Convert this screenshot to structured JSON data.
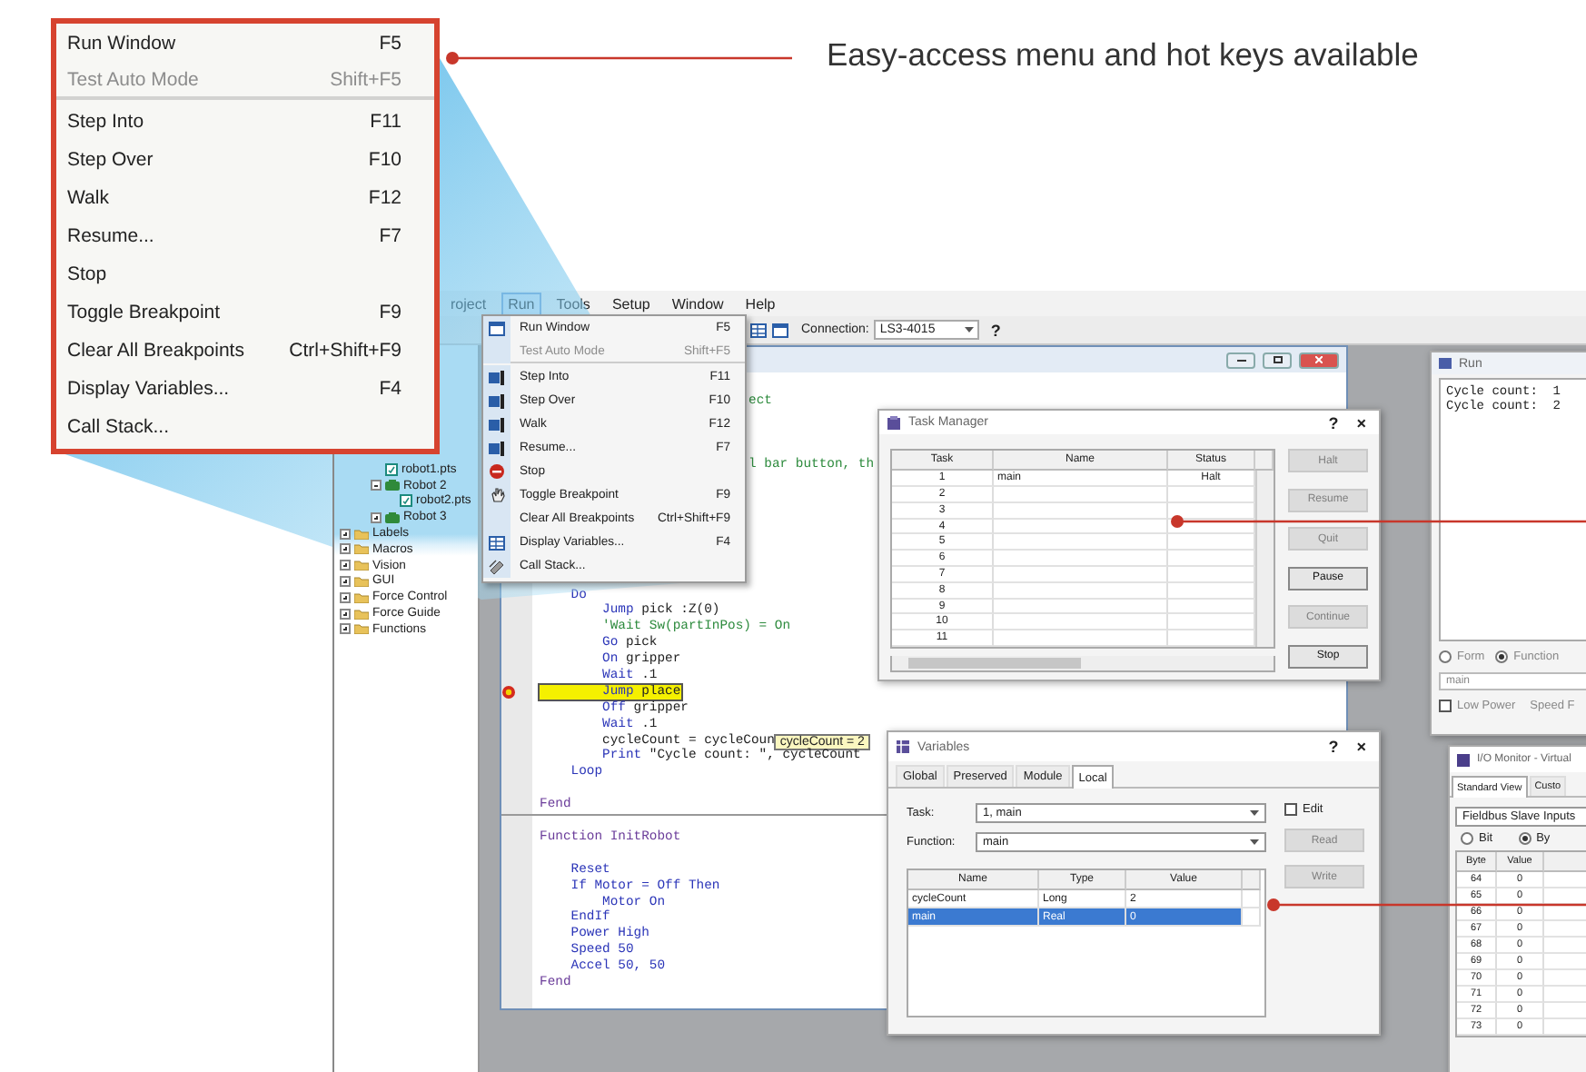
{
  "callout": {
    "caption": "Easy-access menu and hot keys available"
  },
  "zoomed_menu": {
    "items": [
      {
        "label": "Run Window",
        "shortcut": "F5",
        "disabled": false,
        "separator_after": false
      },
      {
        "label": "Test Auto Mode",
        "shortcut": "Shift+F5",
        "disabled": true,
        "separator_after": true
      },
      {
        "label": "Step Into",
        "shortcut": "F11",
        "disabled": false,
        "separator_after": false
      },
      {
        "label": "Step Over",
        "shortcut": "F10",
        "disabled": false,
        "separator_after": false
      },
      {
        "label": "Walk",
        "shortcut": "F12",
        "disabled": false,
        "separator_after": false
      },
      {
        "label": "Resume...",
        "shortcut": "F7",
        "disabled": false,
        "separator_after": false
      },
      {
        "label": "Stop",
        "disabled": false,
        "separator_after": false
      },
      {
        "label": "Toggle Breakpoint",
        "shortcut": "F9",
        "disabled": false,
        "separator_after": false
      },
      {
        "label": "Clear All Breakpoints",
        "shortcut": "Ctrl+Shift+F9",
        "disabled": false,
        "separator_after": false
      },
      {
        "label": "Display Variables...",
        "shortcut": "F4",
        "disabled": false,
        "separator_after": false
      },
      {
        "label": "Call Stack...",
        "disabled": false,
        "separator_after": false
      }
    ]
  },
  "menu_bar": [
    {
      "label": "roject",
      "selected": false
    },
    {
      "label": "Run",
      "selected": true
    },
    {
      "label": "Tools",
      "selected": false
    },
    {
      "label": "Setup",
      "selected": false
    },
    {
      "label": "Window",
      "selected": false
    },
    {
      "label": "Help",
      "selected": false
    }
  ],
  "toolbar": {
    "connection_label": "Connection:",
    "connection": "LS3-4015",
    "help": "?"
  },
  "tree": {
    "robots": [
      {
        "label": "robot1.pts",
        "kind": "file"
      },
      {
        "label": "Robot 2",
        "kind": "robot",
        "expanded": true,
        "children": [
          {
            "label": "robot2.pts",
            "kind": "file"
          }
        ]
      },
      {
        "label": "Robot 3",
        "kind": "robot",
        "expanded": false
      }
    ],
    "folders": [
      {
        "label": "Labels",
        "expanded": false
      },
      {
        "label": "Macros",
        "expanded": false
      },
      {
        "label": "Vision",
        "expanded": false
      },
      {
        "label": "GUI",
        "expanded": false
      },
      {
        "label": "Force Control",
        "expanded": false
      },
      {
        "label": "Force Guide",
        "expanded": false
      },
      {
        "label": "Functions",
        "expanded": false
      }
    ]
  },
  "run_menu": {
    "items": [
      {
        "label": "Run Window",
        "shortcut": "F5",
        "disabled": false,
        "separator_after": false
      },
      {
        "label": "Test Auto Mode",
        "shortcut": "Shift+F5",
        "disabled": true,
        "separator_after": true
      },
      {
        "label": "Step Into",
        "shortcut": "F11",
        "disabled": false,
        "separator_after": false
      },
      {
        "label": "Step Over",
        "shortcut": "F10",
        "disabled": false,
        "separator_after": false
      },
      {
        "label": "Walk",
        "shortcut": "F12",
        "disabled": false,
        "separator_after": false
      },
      {
        "label": "Resume...",
        "shortcut": "F7",
        "disabled": false,
        "separator_after": false
      },
      {
        "label": "Stop",
        "disabled": false,
        "separator_after": false
      },
      {
        "label": "Toggle Breakpoint",
        "shortcut": "F9",
        "disabled": false,
        "separator_after": false
      },
      {
        "label": "Clear All Breakpoints",
        "shortcut": "Ctrl+Shift+F9",
        "disabled": false,
        "separator_after": false
      },
      {
        "label": "Display Variables...",
        "shortcut": "F4",
        "disabled": false,
        "separator_after": false
      },
      {
        "label": "Call Stack...",
        "disabled": false,
        "separator_after": false
      }
    ]
  },
  "editor": {
    "lines": [
      {
        "kind": "blank"
      },
      {
        "kind": "fragment",
        "text": "ect"
      },
      {
        "kind": "blank"
      },
      {
        "kind": "blank"
      },
      {
        "kind": "blank"
      },
      {
        "kind": "fragment",
        "text": "l bar button, th"
      },
      {
        "kind": "blank"
      },
      {
        "kind": "blank"
      },
      {
        "kind": "blank"
      },
      {
        "kind": "blank"
      },
      {
        "kind": "blank"
      },
      {
        "kind": "blank"
      },
      {
        "kind": "blank"
      },
      {
        "kind": "code",
        "keyword": "    Do"
      },
      {
        "kind": "code",
        "keyword": "        Jump",
        "text": " pick :Z(0)"
      },
      {
        "kind": "comment",
        "text": "        'Wait Sw(partInPos) = On"
      },
      {
        "kind": "code",
        "keyword": "        Go",
        "text": " pick"
      },
      {
        "kind": "code",
        "keyword": "        On",
        "text": " gripper"
      },
      {
        "kind": "code",
        "keyword": "        Wait",
        "text": " .1"
      },
      {
        "kind": "code",
        "keyword": "        Jump",
        "text": " place",
        "current": true,
        "breakpoint": true
      },
      {
        "kind": "code",
        "keyword": "        Off",
        "text": " gripper"
      },
      {
        "kind": "code",
        "keyword": "        Wait",
        "text": " .1"
      },
      {
        "kind": "code",
        "text": "        cycleCount = cycleCoun",
        "tooltip": "cycleCount = 2"
      },
      {
        "kind": "code",
        "keyword": "        Print",
        "text": " \"Cycle count: \", cycleCount"
      },
      {
        "kind": "code",
        "keyword": "    Loop"
      },
      {
        "kind": "blank"
      },
      {
        "kind": "block",
        "text": "Fend"
      },
      {
        "kind": "divider"
      },
      {
        "kind": "block",
        "text": "Function InitRobot"
      },
      {
        "kind": "blank"
      },
      {
        "kind": "code",
        "keyword": "    Reset"
      },
      {
        "kind": "code",
        "keyword": "    If Motor = Off Then"
      },
      {
        "kind": "code",
        "keyword": "        Motor On"
      },
      {
        "kind": "code",
        "keyword": "    EndIf"
      },
      {
        "kind": "code",
        "keyword": "    Power High"
      },
      {
        "kind": "code",
        "keyword": "    Speed 50"
      },
      {
        "kind": "code",
        "keyword": "    Accel 50, 50"
      },
      {
        "kind": "block",
        "text": "Fend"
      }
    ]
  },
  "task_manager": {
    "title": "Task Manager",
    "help": "?",
    "close": "×",
    "columns": [
      "Task",
      "Name",
      "Status"
    ],
    "rows": [
      [
        "1",
        "main",
        "Halt"
      ],
      [
        "2"
      ],
      [
        "3"
      ],
      [
        "4"
      ],
      [
        "5"
      ],
      [
        "6"
      ],
      [
        "7"
      ],
      [
        "8"
      ],
      [
        "9"
      ],
      [
        "10"
      ],
      [
        "11"
      ]
    ],
    "buttons": [
      {
        "label": "Halt",
        "disabled": true
      },
      {
        "label": "Resume",
        "disabled": true
      },
      {
        "label": "Quit",
        "disabled": true
      },
      {
        "label": "Pause",
        "disabled": false
      },
      {
        "label": "Continue",
        "disabled": true
      },
      {
        "label": "Stop",
        "disabled": false
      }
    ]
  },
  "variables": {
    "title": "Variables",
    "help": "?",
    "close": "×",
    "tabs": [
      {
        "label": "Global",
        "selected": false
      },
      {
        "label": "Preserved",
        "selected": false
      },
      {
        "label": "Module",
        "selected": false
      },
      {
        "label": "Local",
        "selected": true
      }
    ],
    "task_label": "Task:",
    "task": "1, main",
    "function_label": "Function:",
    "function": "main",
    "edit": {
      "label": "Edit",
      "checked": false
    },
    "buttons": [
      {
        "label": "Read",
        "disabled": true
      },
      {
        "label": "Write",
        "disabled": true
      }
    ],
    "columns": [
      "Name",
      "Type",
      "Value"
    ],
    "rows": [
      {
        "cells": [
          "cycleCount",
          "Long",
          "2"
        ],
        "selected": false
      },
      {
        "cells": [
          "main",
          "Real",
          "0"
        ],
        "selected": true
      }
    ]
  },
  "run_window": {
    "title": "Run",
    "output": [
      "Cycle count:  1",
      "Cycle count:  2"
    ],
    "radios": [
      {
        "label": "Form",
        "selected": false
      },
      {
        "label": "Function",
        "selected": true
      }
    ],
    "function": "main",
    "low_power": {
      "label": "Low Power",
      "checked": false
    },
    "speed_label": "Speed F"
  },
  "io_monitor": {
    "title": "I/O Monitor - Virtual",
    "tabs": [
      {
        "label": "Standard View",
        "selected": true
      },
      {
        "label": "Custo",
        "selected": false
      }
    ],
    "source": "Fieldbus Slave Inputs",
    "radios": [
      {
        "label": "Bit",
        "selected": false
      },
      {
        "label": "By",
        "selected": true
      }
    ],
    "columns": [
      "Byte",
      "Value"
    ],
    "rows": [
      [
        "64",
        "0"
      ],
      [
        "65",
        "0"
      ],
      [
        "66",
        "0"
      ],
      [
        "67",
        "0"
      ],
      [
        "68",
        "0"
      ],
      [
        "69",
        "0"
      ],
      [
        "70",
        "0"
      ],
      [
        "71",
        "0"
      ],
      [
        "72",
        "0"
      ],
      [
        "73",
        "0"
      ]
    ]
  }
}
